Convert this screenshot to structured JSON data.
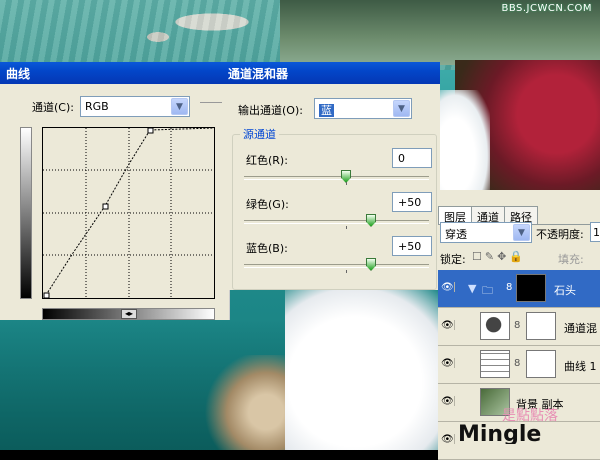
{
  "watermark": "BBS.JCWCN.COM",
  "curves": {
    "title": "曲线",
    "channel_label": "通道(C):",
    "channel_value": "RGB"
  },
  "mixer": {
    "title": "通道混和器",
    "output_label": "输出通道(O):",
    "output_value": "蓝",
    "group_label": "源通道",
    "red_label": "红色(R):",
    "red_value": "0",
    "green_label": "绿色(G):",
    "green_value": "+50",
    "blue_label": "蓝色(B):",
    "blue_value": "+50",
    "sliders": {
      "red": 0,
      "green": 50,
      "blue": 50
    }
  },
  "layers": {
    "tabs": [
      "图层",
      "通道",
      "路径"
    ],
    "blend_mode": "穿透",
    "opacity_label": "不透明度:",
    "opacity_value": "1",
    "lock_label": "锁定:",
    "fill_label": "填充:",
    "rows": [
      {
        "name": "石头",
        "type": "group"
      },
      {
        "name": "通道混",
        "type": "mixer"
      },
      {
        "name": "曲线 1",
        "type": "curves"
      },
      {
        "name": "背景 副本",
        "type": "image"
      }
    ]
  },
  "logo": {
    "text": "Mingle",
    "mark": "是點點落"
  },
  "colors": {
    "title_bar": "#0346c9",
    "selected_row": "#316ac5",
    "dialog_bg": "#ece9d8"
  }
}
